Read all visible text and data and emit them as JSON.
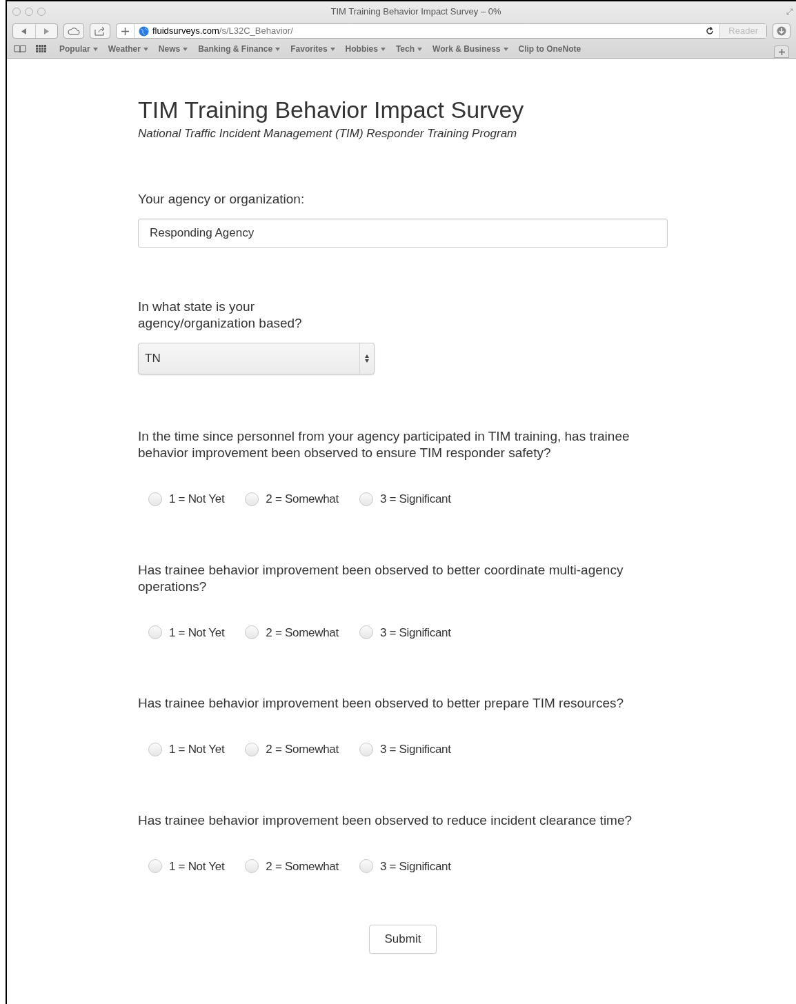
{
  "window": {
    "title": "TIM Training Behavior Impact Survey – 0%"
  },
  "toolbar": {
    "url_domain": "fluidsurveys.com",
    "url_path": "/s/L32C_Behavior/",
    "reader": "Reader"
  },
  "bookmarks": [
    {
      "label": "Popular",
      "menu": true
    },
    {
      "label": "Weather",
      "menu": true
    },
    {
      "label": "News",
      "menu": true
    },
    {
      "label": "Banking & Finance",
      "menu": true
    },
    {
      "label": "Favorites",
      "menu": true
    },
    {
      "label": "Hobbies",
      "menu": true
    },
    {
      "label": "Tech",
      "menu": true
    },
    {
      "label": "Work & Business",
      "menu": true
    },
    {
      "label": "Clip to OneNote",
      "menu": false
    }
  ],
  "survey": {
    "title": "TIM Training Behavior Impact Survey",
    "subtitle": "National Traffic Incident Management (TIM) Responder Training Program"
  },
  "questions": [
    {
      "kind": "text",
      "label": "Your agency or organization:",
      "value": "Responding Agency"
    },
    {
      "kind": "select",
      "label_lines": [
        "In what state is your",
        "agency/organization based?"
      ],
      "value": "TN"
    },
    {
      "kind": "radio",
      "label": "In the time since personnel from your agency participated in TIM training, has trainee behavior improvement been observed to ensure TIM responder safety?",
      "options": [
        {
          "label": "1 = Not Yet",
          "selected": false
        },
        {
          "label": "2 = Somewhat",
          "selected": false
        },
        {
          "label": "3 = Significant",
          "selected": false
        }
      ]
    },
    {
      "kind": "radio",
      "label": "Has trainee behavior improvement been observed to better coordinate multi-agency operations?",
      "options": [
        {
          "label": "1 = Not Yet",
          "selected": false
        },
        {
          "label": "2 = Somewhat",
          "selected": false
        },
        {
          "label": "3 = Significant",
          "selected": false
        }
      ]
    },
    {
      "kind": "radio",
      "label": "Has trainee behavior improvement been observed to better prepare TIM resources?",
      "options": [
        {
          "label": "1 = Not Yet",
          "selected": false
        },
        {
          "label": "2 = Somewhat",
          "selected": false
        },
        {
          "label": "3 = Significant",
          "selected": false
        }
      ]
    },
    {
      "kind": "radio",
      "label": "Has trainee behavior improvement been observed to reduce incident clearance time?",
      "options": [
        {
          "label": "1 = Not Yet",
          "selected": false
        },
        {
          "label": "2 = Somewhat",
          "selected": false
        },
        {
          "label": "3 = Significant",
          "selected": false
        }
      ]
    }
  ],
  "submit": "Submit"
}
